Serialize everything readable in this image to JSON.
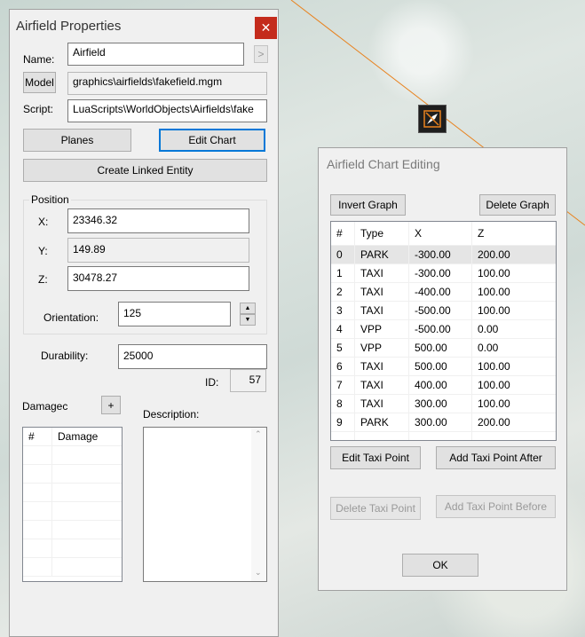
{
  "props_window": {
    "title": "Airfield Properties",
    "close_icon": "close-icon",
    "name_label": "Name:",
    "name_value": "Airfield",
    "name_arrow": ">",
    "model_button": "Model",
    "model_value": "graphics\\airfields\\fakefield.mgm",
    "script_label": "Script:",
    "script_value": "LuaScripts\\WorldObjects\\Airfields\\fake",
    "planes_button": "Planes",
    "edit_chart_button": "Edit Chart",
    "linked_entity_button": "Create Linked Entity",
    "position_label": "Position",
    "x_label": "X:",
    "x_value": "23346.32",
    "y_label": "Y:",
    "y_value": "149.89",
    "z_label": "Z:",
    "z_value": "30478.27",
    "orientation_label": "Orientation:",
    "orientation_value": "125",
    "durability_label": "Durability:",
    "durability_value": "25000",
    "id_label": "ID:",
    "id_value": "57",
    "damaged_label": "Damagec",
    "add_damage_button": "+",
    "description_label": "Description:",
    "damage_columns": [
      "#",
      "Damage"
    ]
  },
  "chart_window": {
    "title": "Airfield Chart Editing",
    "invert_button": "Invert Graph",
    "delete_graph_button": "Delete Graph",
    "columns": [
      "#",
      "Type",
      "X",
      "Z"
    ],
    "rows": [
      [
        "0",
        "PARK",
        "-300.00",
        "200.00"
      ],
      [
        "1",
        "TAXI",
        "-300.00",
        "100.00"
      ],
      [
        "2",
        "TAXI",
        "-400.00",
        "100.00"
      ],
      [
        "3",
        "TAXI",
        "-500.00",
        "100.00"
      ],
      [
        "4",
        "VPP",
        "-500.00",
        "0.00"
      ],
      [
        "5",
        "VPP",
        "500.00",
        "0.00"
      ],
      [
        "6",
        "TAXI",
        "500.00",
        "100.00"
      ],
      [
        "7",
        "TAXI",
        "400.00",
        "100.00"
      ],
      [
        "8",
        "TAXI",
        "300.00",
        "100.00"
      ],
      [
        "9",
        "PARK",
        "300.00",
        "200.00"
      ]
    ],
    "edit_taxi_button": "Edit Taxi Point",
    "add_after_button": "Add Taxi Point After",
    "delete_taxi_button": "Delete Taxi Point",
    "add_before_button": "Add Taxi Point Before",
    "ok_button": "OK"
  },
  "map": {
    "marker_icon": "airfield-marker-icon",
    "route_color": "#e8821e"
  }
}
